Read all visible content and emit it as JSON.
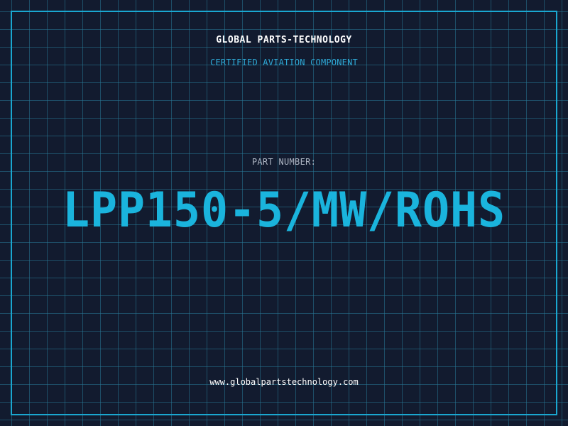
{
  "header": {
    "brand": "GLOBAL PARTS-TECHNOLOGY",
    "subtitle": "CERTIFIED AVIATION COMPONENT"
  },
  "part": {
    "label": "PART NUMBER:",
    "number": "LPP150-5/MW/ROHS"
  },
  "footer": {
    "website": "www.globalpartstechnology.com"
  },
  "colors": {
    "background": "#121b2f",
    "grid": "#28789a",
    "accent": "#1aa7d0",
    "part_number": "#1ab4dd",
    "text_primary": "#ffffff",
    "text_muted": "#aeb6c4"
  }
}
